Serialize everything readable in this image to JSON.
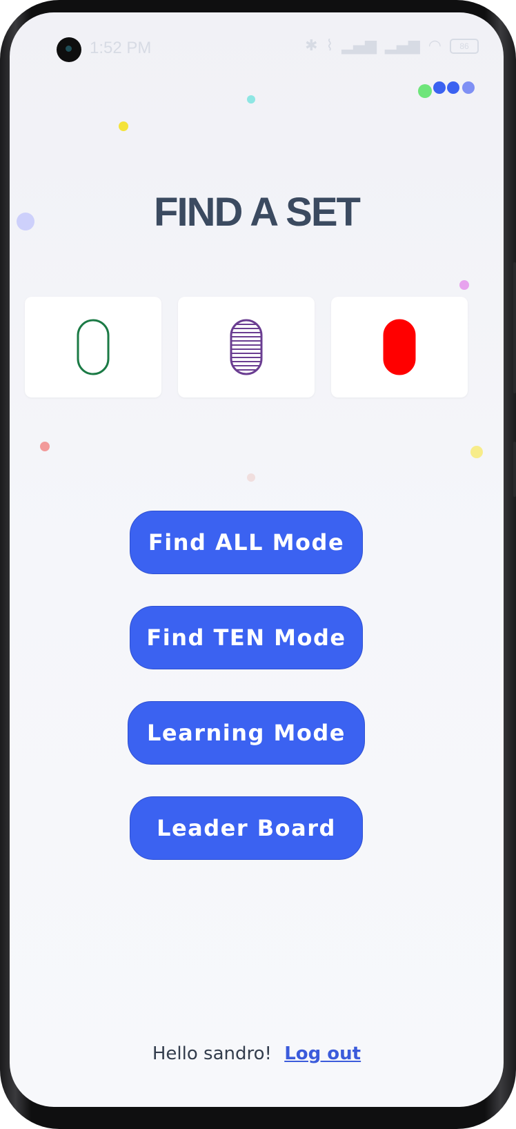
{
  "status_bar": {
    "time": "1:52 PM",
    "icons": [
      "bluetooth-icon",
      "bell-off-icon",
      "signal-icon",
      "signal-icon",
      "wifi-icon"
    ],
    "battery": "86"
  },
  "main": {
    "title": "FIND A SET",
    "cards": [
      {
        "shape": "oval",
        "fill": "empty",
        "color": "#1b7a45"
      },
      {
        "shape": "oval",
        "fill": "striped",
        "color": "#6a3d91"
      },
      {
        "shape": "oval",
        "fill": "solid",
        "color": "#ff0000"
      }
    ],
    "buttons": {
      "find_all": "Find ALL Mode",
      "find_ten": "Find TEN Mode",
      "learning": "Learning Mode",
      "leader_board": "Leader Board"
    }
  },
  "footer": {
    "greeting": "Hello sandro!",
    "logout": "Log out"
  },
  "colors": {
    "accent": "#3b62f1",
    "title": "#3b4a60",
    "background": "#f4f5f9"
  }
}
